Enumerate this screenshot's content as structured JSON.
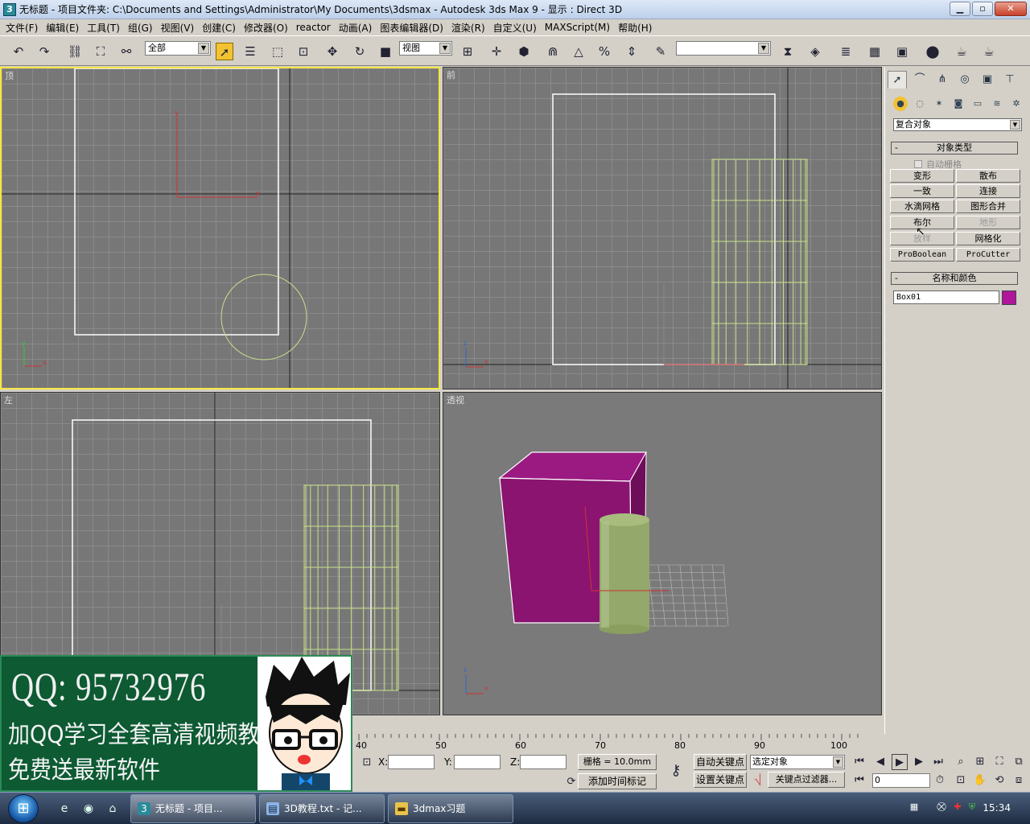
{
  "window": {
    "title": "无标题   - 项目文件夹: C:\\Documents and Settings\\Administrator\\My Documents\\3dsmax    - Autodesk 3ds Max 9     - 显示 : Direct 3D",
    "app_icon": "3",
    "minimize": "▁",
    "maximize": "▫",
    "close": "✕"
  },
  "menu": [
    "文件(F)",
    "编辑(E)",
    "工具(T)",
    "组(G)",
    "视图(V)",
    "创建(C)",
    "修改器(O)",
    "reactor",
    "动画(A)",
    "图表编辑器(D)",
    "渲染(R)",
    "自定义(U)",
    "MAXScript(M)",
    "帮助(H)"
  ],
  "toolbar": {
    "selection_filter": "全部",
    "reference_coord": "视图",
    "named_selection": ""
  },
  "viewports": {
    "top": "顶",
    "front": "前",
    "left": "左",
    "perspective": "透视"
  },
  "command_panel": {
    "category": "复合对象",
    "object_type_title": "对象类型",
    "auto_grid": "自动栅格",
    "buttons": [
      {
        "label": "变形",
        "enabled": true
      },
      {
        "label": "散布",
        "enabled": true
      },
      {
        "label": "一致",
        "enabled": true
      },
      {
        "label": "连接",
        "enabled": true
      },
      {
        "label": "水滴网格",
        "enabled": true
      },
      {
        "label": "图形合并",
        "enabled": true
      },
      {
        "label": "布尔",
        "enabled": true
      },
      {
        "label": "地形",
        "enabled": false
      },
      {
        "label": "放样",
        "enabled": false
      },
      {
        "label": "网格化",
        "enabled": true
      },
      {
        "label": "ProBoolean",
        "enabled": true
      },
      {
        "label": "ProCutter",
        "enabled": true
      }
    ],
    "name_color_title": "名称和颜色",
    "object_name": "Box01",
    "object_color": "#b0169a",
    "minus": "-"
  },
  "timeline": {
    "ticks": [
      "40",
      "50",
      "60",
      "70",
      "80",
      "90",
      "100"
    ]
  },
  "status": {
    "x_label": "X:",
    "y_label": "Y:",
    "z_label": "Z:",
    "x_value": "",
    "y_value": "",
    "z_value": "",
    "grid": "栅格 = 10.0mm",
    "add_time_tag": "添加时间标记",
    "auto_key": "自动关键点",
    "set_key": "设置关键点",
    "key_mode": "选定对象",
    "key_filters": "关键点过滤器...",
    "current_frame": "0"
  },
  "overlay": {
    "qq": "QQ: 95732976",
    "line1": "加QQ学习全套高清视频教程",
    "line2": "免费送最新软件"
  },
  "taskbar": {
    "tasks": [
      {
        "label": "无标题     - 项目...",
        "active": true
      },
      {
        "label": "3D教程.txt - 记...",
        "active": false
      },
      {
        "label": "3dmax习题",
        "active": false
      }
    ],
    "clock": "15:34"
  },
  "colors": {
    "viewport_bg": "#777777",
    "active_border": "#f5e642",
    "wire_yellow": "#c8e08a",
    "box_purple": "#8a1470",
    "cylinder_green": "#93a86a",
    "overlay_green": "#0d5a33"
  }
}
